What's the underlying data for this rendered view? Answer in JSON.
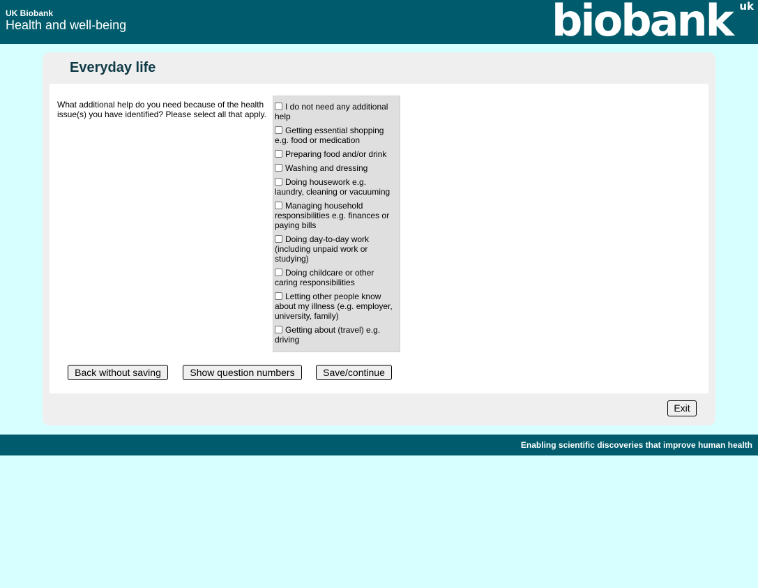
{
  "header": {
    "org": "UK Biobank",
    "app_title": "Health and well-being",
    "logo_text": "biobank",
    "logo_suffix": "uk"
  },
  "page": {
    "title": "Everyday life"
  },
  "question": {
    "text": "What additional help do you need because of the health issue(s) you have identified? Please select all that apply.",
    "options": [
      "I do not need any additional help",
      "Getting essential shopping e.g. food or medication",
      "Preparing food and/or drink",
      "Washing and dressing",
      "Doing housework e.g. laundry, cleaning or vacuuming",
      "Managing household responsibilities e.g. finances or paying bills",
      "Doing day-to-day work (including unpaid work or studying)",
      "Doing childcare or other caring responsibilities",
      "Letting other people know about my illness (e.g. employer, university, family)",
      "Getting about (travel) e.g. driving"
    ]
  },
  "buttons": {
    "back": "Back without saving",
    "show_numbers": "Show question numbers",
    "save": "Save/continue",
    "exit": "Exit"
  },
  "footer": {
    "tagline": "Enabling scientific discoveries that improve human health"
  },
  "colors": {
    "brand": "#005c6c",
    "background": "#d7ffff",
    "panel": "#efefef",
    "options_bg": "#dfdfdf"
  }
}
